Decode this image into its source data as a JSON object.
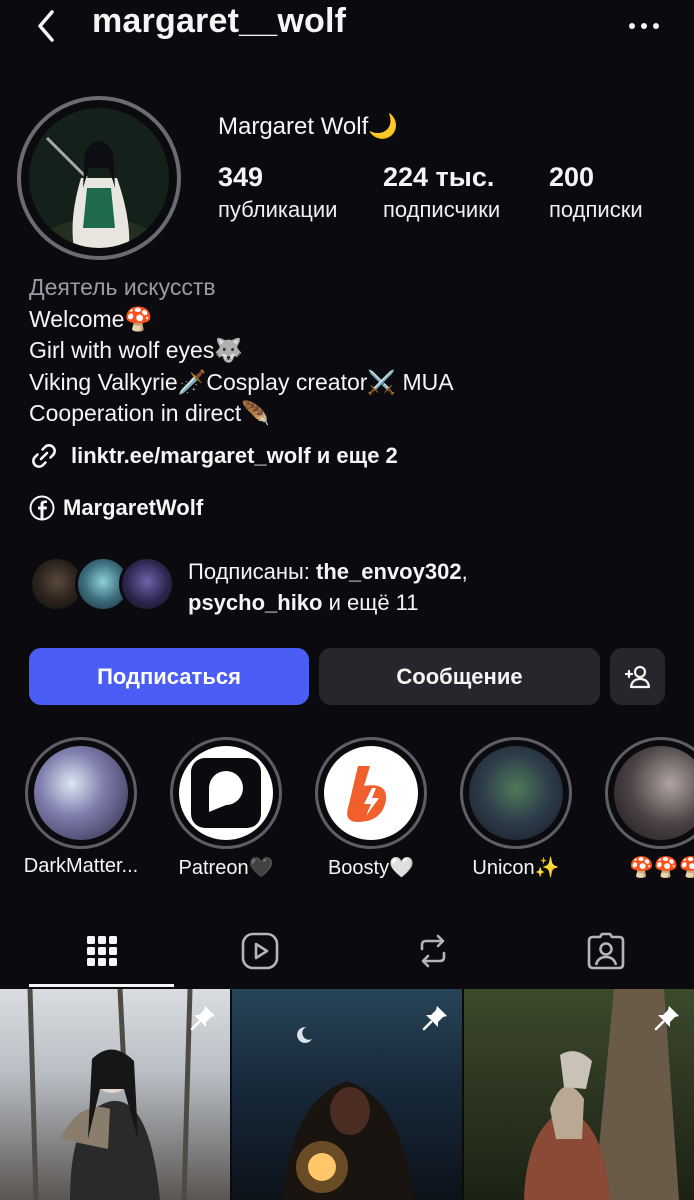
{
  "header": {
    "username": "margaret__wolf",
    "back_icon": "chevron-left-icon",
    "more_icon": "more-horizontal-icon"
  },
  "profile": {
    "display_name": "Margaret Wolf🌙",
    "stats": [
      {
        "value": "349",
        "label": "публикации"
      },
      {
        "value": "224 тыс.",
        "label": "подписчики"
      },
      {
        "value": "200",
        "label": "подписки"
      }
    ],
    "bio": {
      "category": "Деятель искусств",
      "lines": [
        "Welcome🍄",
        "Girl with wolf eyes🐺",
        "Viking Valkyrie🗡️Cosplay creator⚔️ MUA",
        "Cooperation in direct🪶"
      ]
    },
    "link": "linktr.ee/margaret_wolf и еще 2",
    "facebook": "MargaretWolf",
    "followed_by": {
      "prefix": "Подписаны: ",
      "user1": "the_envoy302",
      "sep": ",",
      "user2": "psycho_hiko",
      "suffix": " и ещё 11"
    }
  },
  "actions": {
    "follow": "Подписаться",
    "message": "Сообщение",
    "add_icon": "add-person-icon"
  },
  "highlights": [
    {
      "label": "DarkMatter..."
    },
    {
      "label": "Patreon🖤"
    },
    {
      "label": "Boosty🤍"
    },
    {
      "label": "Unicon✨"
    },
    {
      "label": "🍄🍄🍄"
    }
  ],
  "tabs": [
    {
      "icon": "grid-icon",
      "active": true
    },
    {
      "icon": "reels-icon",
      "active": false
    },
    {
      "icon": "reposts-icon",
      "active": false
    },
    {
      "icon": "tagged-icon",
      "active": false
    }
  ],
  "colors": {
    "background": "#0b0b0f",
    "accent": "#4a5df5",
    "secondary_button": "#26262c",
    "muted_text": "#9a9aa4"
  }
}
